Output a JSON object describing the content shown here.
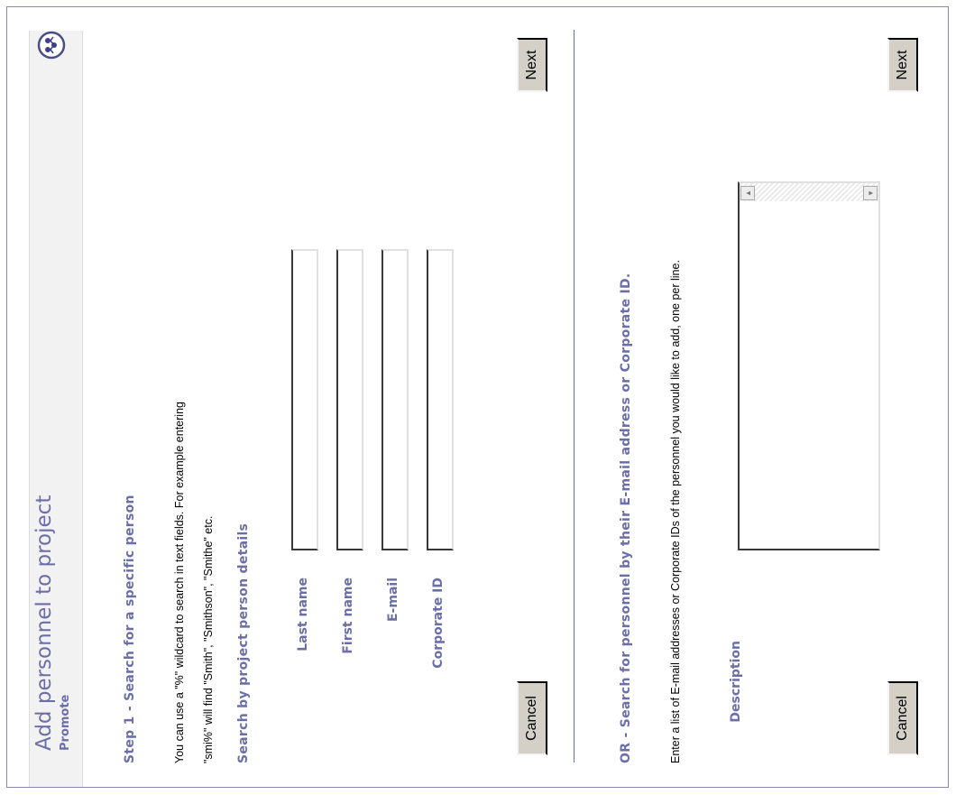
{
  "header": {
    "title": "Add personnel to project",
    "subtitle": "Promote",
    "logo_icon": "people-logo-icon"
  },
  "step1": {
    "title": "Step 1 - Search for a specific person",
    "help_line1": "You can use a \"%\" wildcard to search in text fields. For example entering",
    "help_line2": "\"smi%\" will find \"Smith\", \"Smithson\", \"Smithe\" etc.",
    "subheading": "Search by project person details",
    "fields": [
      {
        "label": "Last name",
        "value": ""
      },
      {
        "label": "First name",
        "value": ""
      },
      {
        "label": "E-mail",
        "value": ""
      },
      {
        "label": "Corporate ID",
        "value": ""
      }
    ],
    "cancel_label": "Cancel",
    "next_label": "Next"
  },
  "step2": {
    "title": "OR - Search for personnel by their E-mail address or Corporate ID.",
    "help": "Enter a list of E-mail addresses or Corporate IDs of the personnel you would like to add, one per line.",
    "description_label": "Description",
    "description_value": "",
    "cancel_label": "Cancel",
    "next_label": "Next"
  },
  "colors": {
    "accent": "#6b6fa8",
    "button_bg": "#d4d0c8",
    "border": "#8a88b0"
  }
}
